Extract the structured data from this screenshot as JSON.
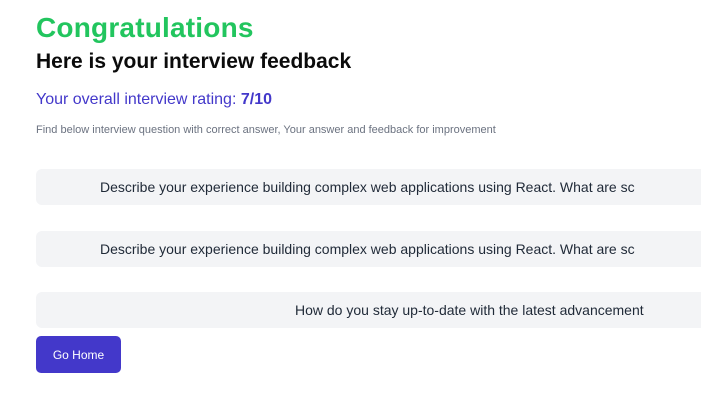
{
  "header": {
    "title": "Congratulations",
    "subtitle": "Here is your interview feedback",
    "rating_label": "Your overall interview rating:",
    "rating_value": "7/10",
    "hint": "Find below interview question with correct answer, Your answer and feedback for improvement"
  },
  "questions": [
    {
      "text": "Describe your experience building complex web applications using React. What are sc"
    },
    {
      "text": "Describe your experience building complex web applications using React. What are sc"
    },
    {
      "text": "How do you stay up-to-date with the latest advancement"
    }
  ],
  "actions": {
    "home_label": "Go Home"
  },
  "colors": {
    "title": "#22c55e",
    "accent": "#4338ca",
    "question_bg": "#f3f4f6"
  }
}
